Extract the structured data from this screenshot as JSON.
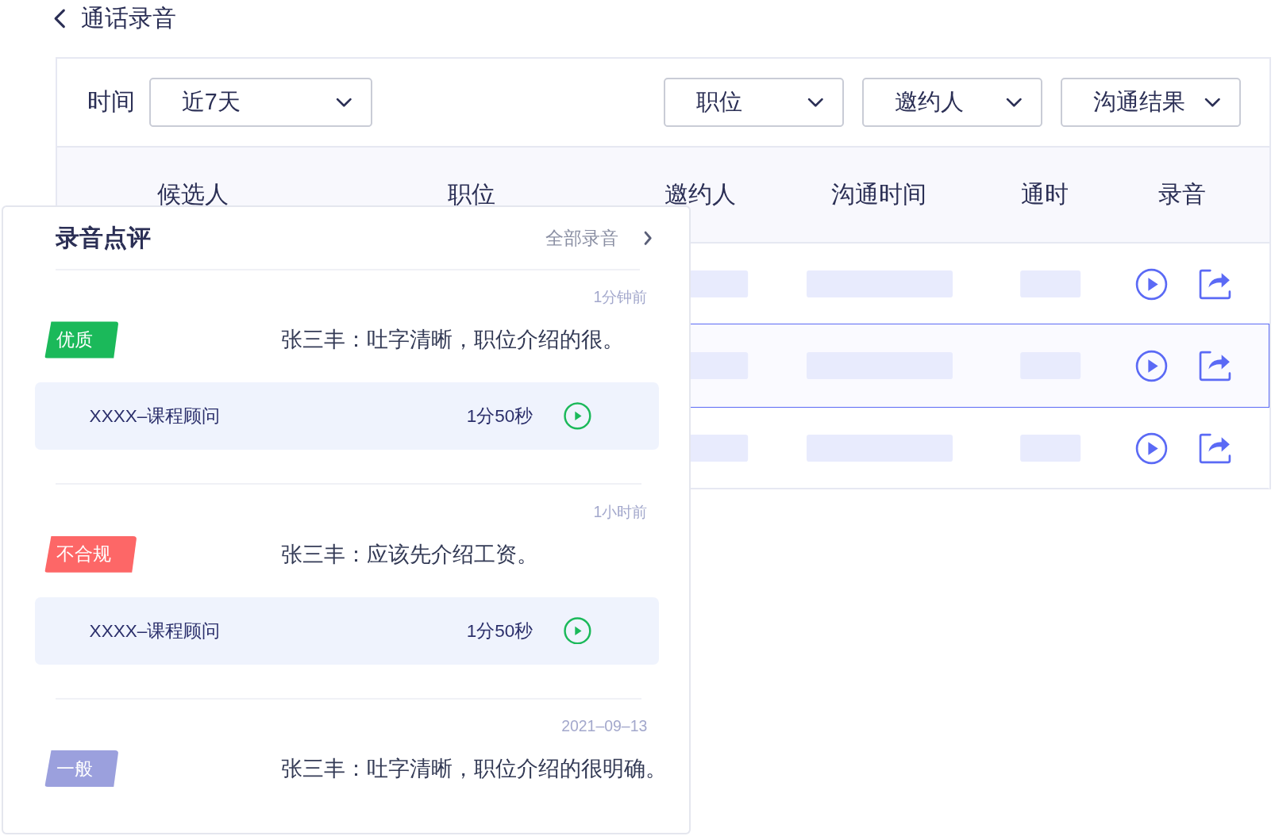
{
  "header": {
    "title": "通话录音"
  },
  "filters": {
    "time_label": "时间",
    "time_value": "近7天",
    "selects": [
      {
        "label": "职位"
      },
      {
        "label": "邀约人"
      },
      {
        "label": "沟通结果"
      }
    ]
  },
  "table": {
    "columns": [
      "候选人",
      "职位",
      "邀约人",
      "沟通时间",
      "通时",
      "录音"
    ],
    "rows": [
      {
        "selected": false
      },
      {
        "selected": true
      },
      {
        "selected": false
      }
    ]
  },
  "review_panel": {
    "title": "录音点评",
    "link": "全部录音",
    "items": [
      {
        "time": "1分钟前",
        "tag": "优质",
        "color": "#1bb95a",
        "comment": "张三丰：吐字清晰，职位介绍的很。",
        "audio": {
          "title": "XXXX–课程顾问",
          "duration": "1分50秒"
        }
      },
      {
        "time": "1小时前",
        "tag": "不合规",
        "color": "#fd6767",
        "comment": "张三丰：应该先介绍工资。",
        "audio": {
          "title": "XXXX–课程顾问",
          "duration": "1分50秒"
        }
      },
      {
        "time": "2021–09–13",
        "tag": "一般",
        "color": "#9ba0dd",
        "comment": "张三丰：吐字清晰，职位介绍的很明确。"
      }
    ]
  }
}
